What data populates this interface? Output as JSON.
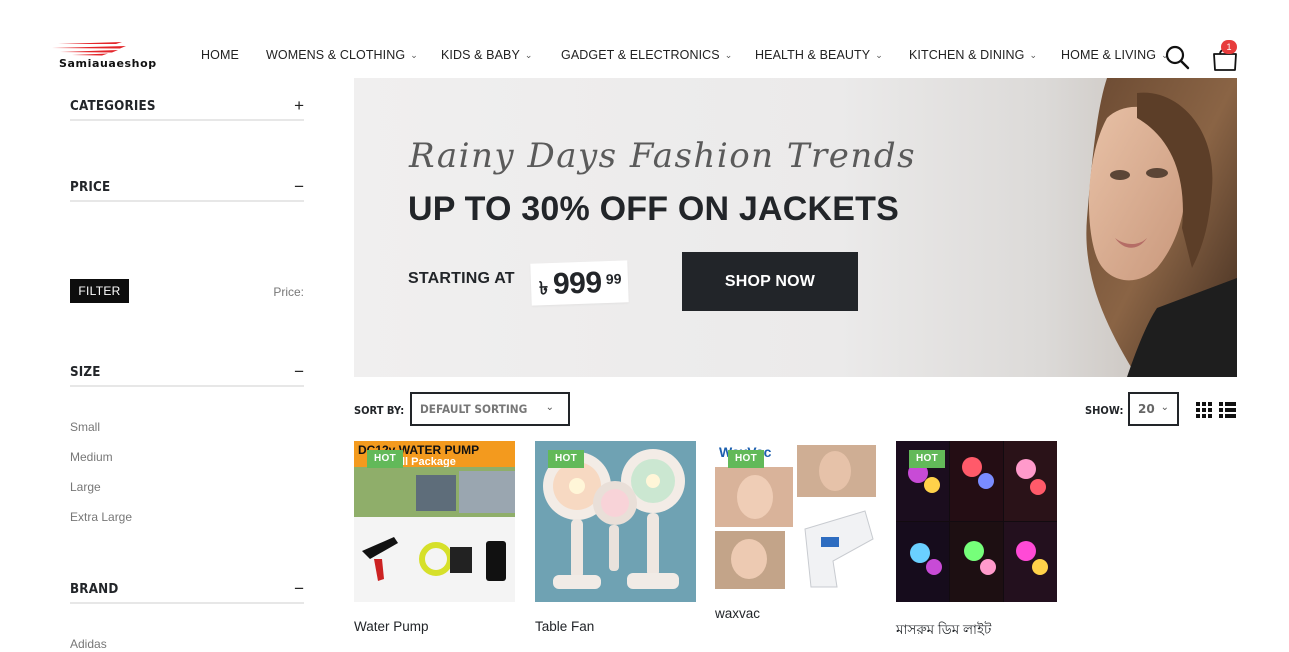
{
  "header": {
    "logo_text": "Samiauaeshop",
    "nav": [
      {
        "label": "HOME",
        "dropdown": false
      },
      {
        "label": "WOMENS & CLOTHING",
        "dropdown": true
      },
      {
        "label": "KIDS & BABY",
        "dropdown": true
      },
      {
        "label": "GADGET & ELECTRONICS",
        "dropdown": true
      },
      {
        "label": "HEALTH & BEAUTY",
        "dropdown": true
      },
      {
        "label": "KITCHEN & DINING",
        "dropdown": true
      },
      {
        "label": "HOME & LIVING",
        "dropdown": true
      }
    ],
    "cart_count": "1",
    "icons": {
      "search": "search-icon",
      "cart": "shopping-bag-icon"
    }
  },
  "sidebar": {
    "categories": {
      "title": "CATEGORIES",
      "toggle": "+"
    },
    "price": {
      "title": "PRICE",
      "toggle": "−",
      "filter_label": "FILTER",
      "price_label": "Price:"
    },
    "size": {
      "title": "SIZE",
      "toggle": "−",
      "items": [
        "Small",
        "Medium",
        "Large",
        "Extra Large"
      ]
    },
    "brand": {
      "title": "BRAND",
      "toggle": "−",
      "items": [
        "Adidas"
      ]
    }
  },
  "banner": {
    "script_text": "Rainy Days Fashion Trends",
    "headline": "UP TO 30% OFF ON JACKETS",
    "starting_at": "STARTING AT",
    "currency": "৳",
    "price_main": "999",
    "price_cents": "99",
    "cta": "SHOP NOW"
  },
  "toolbar": {
    "sort_label": "SORT BY:",
    "sort_value": "DEFAULT SORTING",
    "show_label": "SHOW:",
    "show_value": "20"
  },
  "products": [
    {
      "name": "Water Pump",
      "badge": "HOT",
      "image_text": "DC12v WATER PUMP",
      "image_subtext": "ll Package"
    },
    {
      "name": "Table Fan",
      "badge": "HOT"
    },
    {
      "name": "waxvac",
      "badge": "HOT",
      "image_text": "WaxVac"
    },
    {
      "name": "মাসরুম ডিম লাইট",
      "badge": "HOT"
    }
  ],
  "colors": {
    "dark": "#222529",
    "hot_badge": "#62b959",
    "cart_badge": "#e73c3c",
    "logo_red": "#e3262b"
  }
}
